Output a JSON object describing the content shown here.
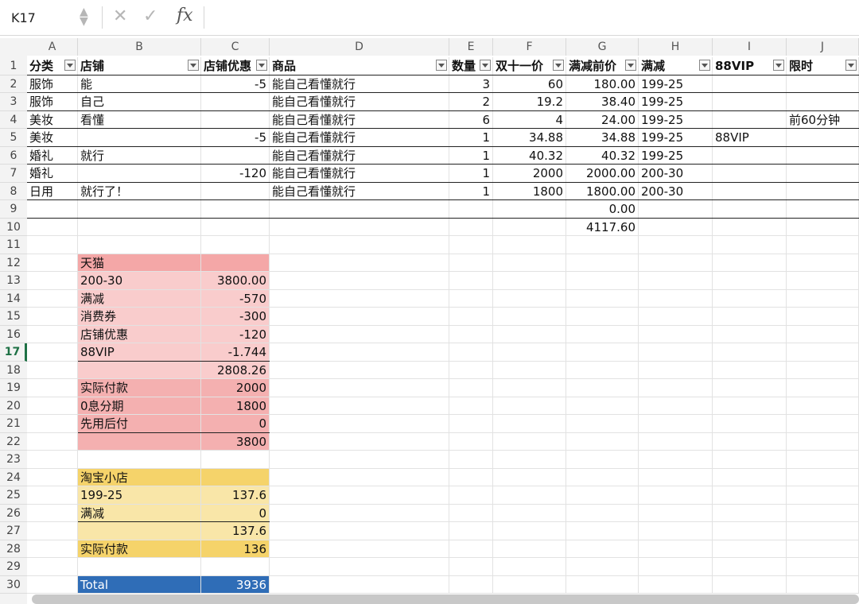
{
  "formula_bar": {
    "name_box": "K17",
    "fx": "fx"
  },
  "columns": [
    "A",
    "B",
    "C",
    "D",
    "E",
    "F",
    "G",
    "H",
    "I",
    "J"
  ],
  "row_numbers": [
    "1",
    "2",
    "3",
    "4",
    "5",
    "6",
    "7",
    "8",
    "9",
    "10",
    "11",
    "12",
    "13",
    "14",
    "15",
    "16",
    "17",
    "18",
    "19",
    "20",
    "21",
    "22",
    "23",
    "24",
    "25",
    "26",
    "27",
    "28",
    "29",
    "30"
  ],
  "active_row": "17",
  "header_row": [
    "分类",
    "店铺",
    "店铺优惠",
    "商品",
    "数量",
    "双十一价",
    "满减前价",
    "满减",
    "88VIP",
    "限时"
  ],
  "rows": [
    [
      "服饰",
      "能",
      "-5",
      "能自己看懂就行",
      "3",
      "60",
      "180.00",
      "199-25",
      "",
      ""
    ],
    [
      "服饰",
      "自己",
      "",
      "能自己看懂就行",
      "2",
      "19.2",
      "38.40",
      "199-25",
      "",
      ""
    ],
    [
      "美妆",
      "看懂",
      "",
      "能自己看懂就行",
      "6",
      "4",
      "24.00",
      "199-25",
      "",
      "前60分钟"
    ],
    [
      "美妆",
      "",
      "-5",
      "能自己看懂就行",
      "1",
      "34.88",
      "34.88",
      "199-25",
      "88VIP",
      ""
    ],
    [
      "婚礼",
      "就行",
      "",
      "能自己看懂就行",
      "1",
      "40.32",
      "40.32",
      "199-25",
      "",
      ""
    ],
    [
      "婚礼",
      "",
      "-120",
      "能自己看懂就行",
      "1",
      "2000",
      "2000.00",
      "200-30",
      "",
      ""
    ],
    [
      "日用",
      "就行了！",
      "",
      "能自己看懂就行",
      "1",
      "1800",
      "1800.00",
      "200-30",
      "",
      ""
    ],
    [
      "",
      "",
      "",
      "",
      "",
      "",
      "0.00",
      "",
      "",
      ""
    ],
    [
      "",
      "",
      "",
      "",
      "",
      "",
      "4117.60",
      "",
      "",
      ""
    ]
  ],
  "tmall": {
    "title": "天猫",
    "lines": [
      [
        "200-30",
        "3800.00"
      ],
      [
        "满减",
        "-570"
      ],
      [
        "消费券",
        "-300"
      ],
      [
        "店铺优惠",
        "-120"
      ],
      [
        "88VIP",
        "-1.744"
      ],
      [
        "",
        "2808.26"
      ],
      [
        "实际付款",
        "2000"
      ],
      [
        "0息分期",
        "1800"
      ],
      [
        "先用后付",
        "0"
      ],
      [
        "",
        "3800"
      ]
    ]
  },
  "taobao": {
    "title": "淘宝小店",
    "lines": [
      [
        "199-25",
        "137.6"
      ],
      [
        "满减",
        "0"
      ],
      [
        "",
        "137.6"
      ],
      [
        "实际付款",
        "136"
      ]
    ]
  },
  "total": {
    "label": "Total",
    "value": "3936"
  },
  "colors": {
    "tmall_title": "#f4a7a7",
    "tmall_body": "#f9cccc",
    "tmall_pay": "#f4b0b0",
    "taobao_title": "#f5d36a",
    "taobao_body": "#f9e6a8",
    "total": "#2f6db7"
  }
}
